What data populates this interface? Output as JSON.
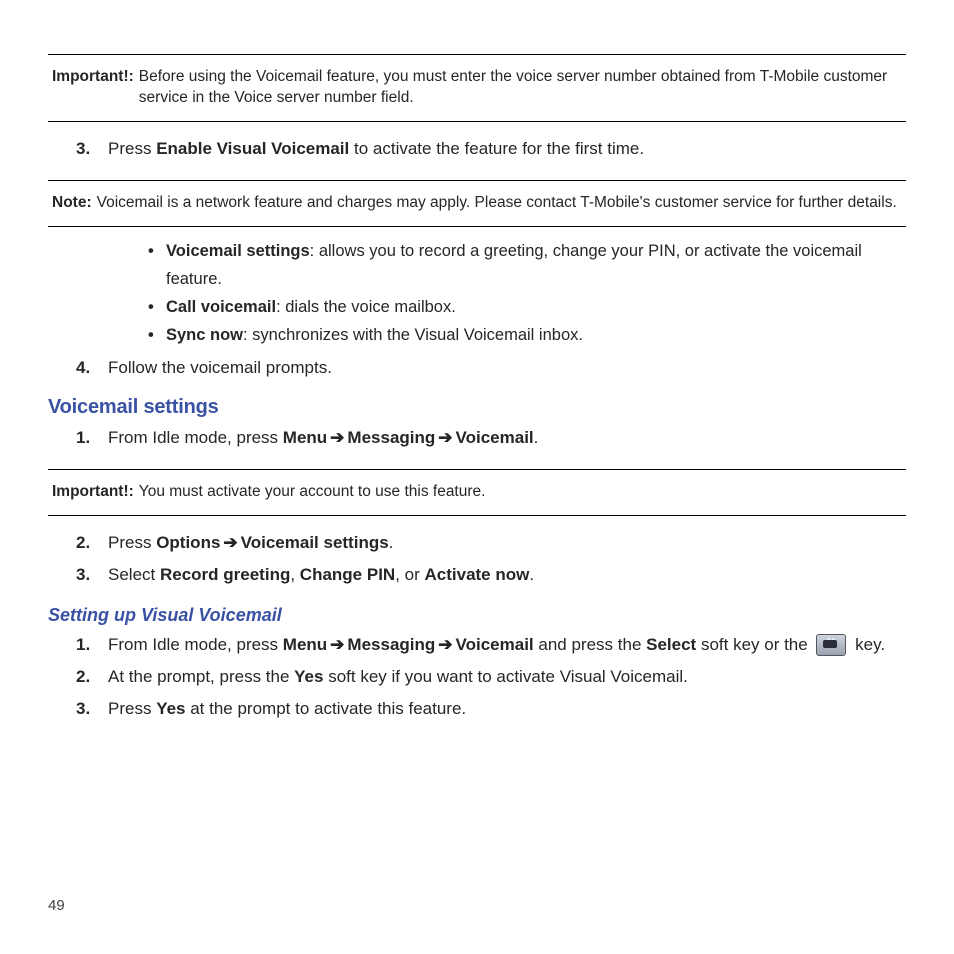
{
  "callout1": {
    "label": "Important!:",
    "text": "Before using the Voicemail feature, you must enter the voice server number obtained from T-Mobile customer service in the Voice server number field."
  },
  "step3a": {
    "num": "3.",
    "pre": "Press ",
    "bold": "Enable Visual Voicemail",
    "post": " to activate the feature for the first time."
  },
  "callout2": {
    "label": "Note:",
    "text": "Voicemail is a network feature and charges may apply. Please contact T-Mobile's customer service for further details."
  },
  "bullets": {
    "b1_bold": "Voicemail settings",
    "b1_rest": ": allows you to record a greeting, change your PIN, or activate the voicemail feature.",
    "b2_bold": "Call voicemail",
    "b2_rest": ": dials the voice mailbox.",
    "b3_bold": "Sync now",
    "b3_rest": ": synchronizes with the Visual Voicemail inbox."
  },
  "step4": {
    "num": "4.",
    "text": "Follow the voicemail prompts."
  },
  "heading1": "Voicemail settings",
  "vset": {
    "s1": {
      "num": "1.",
      "pre": "From Idle mode, press ",
      "m": "Menu",
      "arr": "➔",
      "msg": "Messaging",
      "vm": "Voicemail",
      "end": "."
    }
  },
  "callout3": {
    "label": "Important!:",
    "text": "You must activate your account to use this feature."
  },
  "s2": {
    "num": "2.",
    "pre": "Press ",
    "opt": "Options",
    "arr": "➔",
    "vset": "Voicemail settings",
    "end": "."
  },
  "s3": {
    "num": "3.",
    "pre": "Select ",
    "a": "Record greeting",
    "c1": ", ",
    "b": "Change PIN",
    "c2": ", or ",
    "c": "Activate now",
    "end": "."
  },
  "heading2": "Setting up Visual Voicemail",
  "vv": {
    "s1": {
      "num": "1.",
      "pre": "From Idle mode, press ",
      "m": "Menu",
      "arr": "➔",
      "msg": "Messaging",
      "vm": "Voicemail",
      "mid": " and press the ",
      "sel": "Select",
      "post": " soft key or the ",
      "keytail": " key."
    },
    "s2": {
      "num": "2.",
      "pre": "At the prompt, press the ",
      "yes": "Yes",
      "post": " soft key if you want to activate Visual Voicemail."
    },
    "s3": {
      "num": "3.",
      "pre": "Press ",
      "yes": "Yes",
      "post": " at the prompt to activate this feature."
    }
  },
  "pageNumber": "49"
}
